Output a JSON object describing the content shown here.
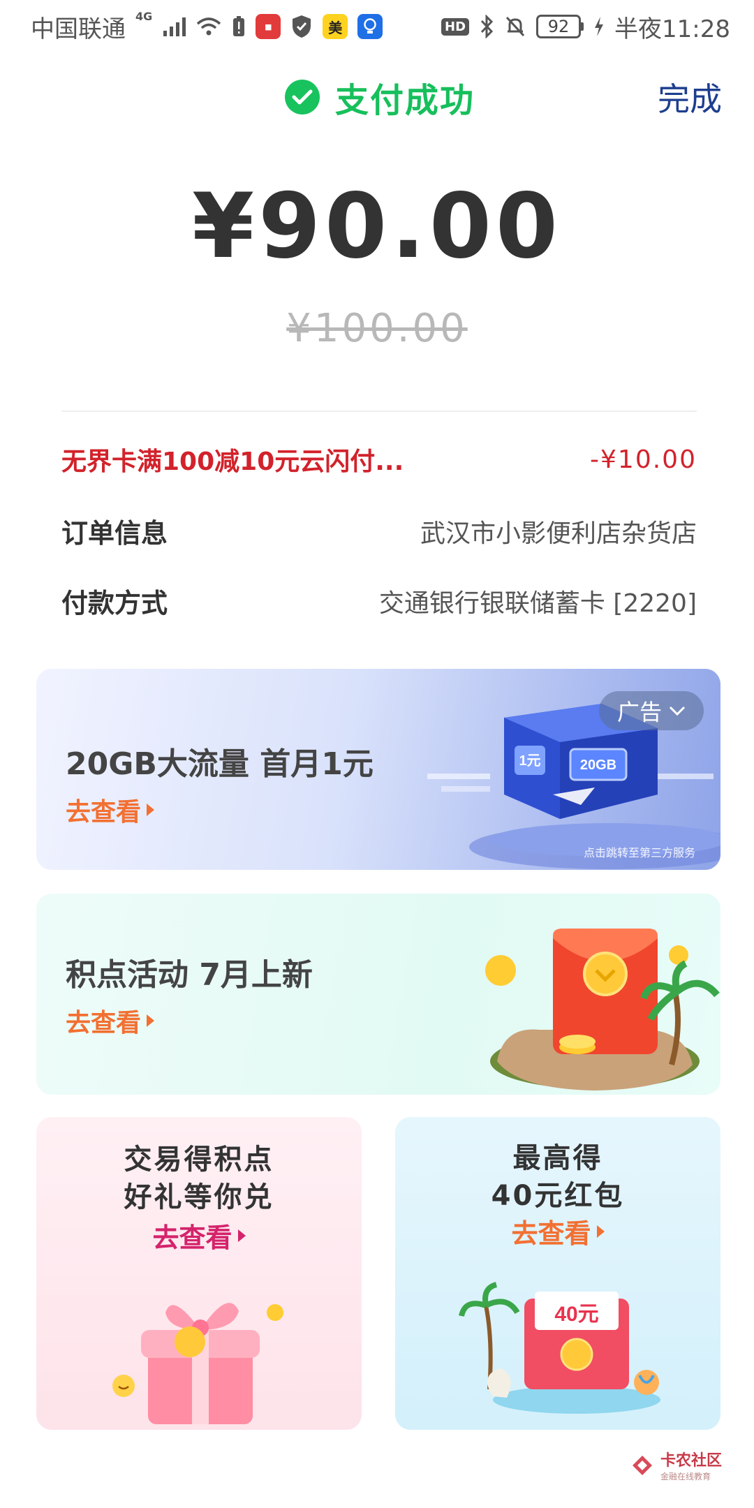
{
  "status_bar": {
    "carrier": "中国联通",
    "network": "4G",
    "hd": "HD",
    "battery": "92",
    "time": "半夜11:28",
    "app_icon_mei": "美"
  },
  "header": {
    "status_text": "支付成功",
    "done_label": "完成",
    "success_color": "#18c35e"
  },
  "payment": {
    "amount": "¥90.00",
    "original_amount": "¥100.00"
  },
  "details": {
    "discount_label": "无界卡满100减10元云闪付...",
    "discount_value": "-¥10.00",
    "order_label": "订单信息",
    "order_value": "武汉市小影便利店杂货店",
    "pay_label": "付款方式",
    "pay_value": "交通银行银联储蓄卡 [2220]"
  },
  "banners": [
    {
      "title": "20GB大流量 首月1元",
      "link": "去查看",
      "ad_tag": "广告",
      "ad_note": "点击跳转至第三方服务",
      "art_label_1": "1元",
      "art_label_2": "20GB"
    },
    {
      "title": "积点活动 7月上新",
      "link": "去查看"
    }
  ],
  "cards": [
    {
      "line1": "交易得积点",
      "line2": "好礼等你兑",
      "link": "去查看",
      "link_color": "#d4236b"
    },
    {
      "line1": "最高得",
      "line2": "40元红包",
      "link": "去查看",
      "link_color": "#f27032",
      "art_label": "40元"
    }
  ],
  "watermark": {
    "main": "卡农社区",
    "sub": "金融在线教育"
  }
}
